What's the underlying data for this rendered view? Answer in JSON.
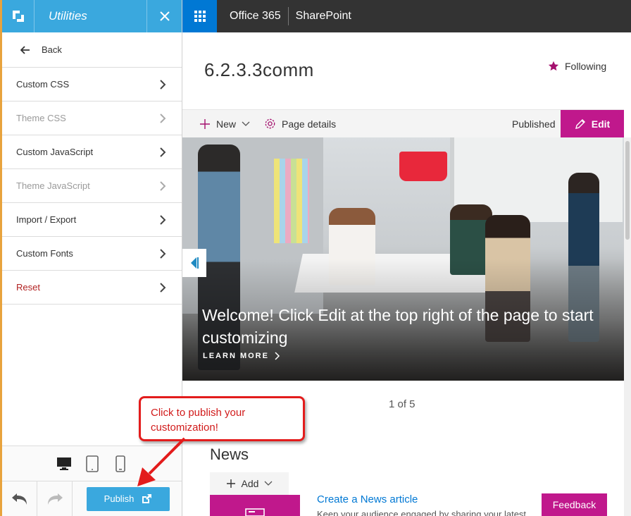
{
  "panel": {
    "title": "Utilities",
    "back_label": "Back",
    "items": [
      {
        "label": "Custom CSS",
        "state": "normal"
      },
      {
        "label": "Theme CSS",
        "state": "muted"
      },
      {
        "label": "Custom JavaScript",
        "state": "normal"
      },
      {
        "label": "Theme JavaScript",
        "state": "muted"
      },
      {
        "label": "Import / Export",
        "state": "normal"
      },
      {
        "label": "Custom Fonts",
        "state": "normal"
      },
      {
        "label": "Reset",
        "state": "danger"
      }
    ],
    "publish_label": "Publish"
  },
  "topbar": {
    "office_label": "Office 365",
    "sharepoint_label": "SharePoint"
  },
  "site": {
    "title": "6.2.3.3comm",
    "following_label": "Following"
  },
  "command_bar": {
    "new_label": "New",
    "page_details_label": "Page details",
    "status": "Published",
    "edit_label": "Edit"
  },
  "hero": {
    "headline": "Welcome! Click Edit at the top right of the page to start customizing",
    "link_label": "LEARN MORE",
    "pager": "1 of 5"
  },
  "news": {
    "title": "News",
    "add_label": "Add",
    "create_link": "Create a News article",
    "description": "Keep your audience engaged by sharing your latest"
  },
  "feedback_label": "Feedback",
  "callout": {
    "line1": "Click to publish your",
    "line2": "customization!"
  },
  "colors": {
    "panel_accent": "#3aa8de",
    "sharepoint_magenta": "#c0188c",
    "suite_bar": "#333333",
    "waffle_blue": "#0078d4",
    "callout_red": "#e31c1c"
  }
}
